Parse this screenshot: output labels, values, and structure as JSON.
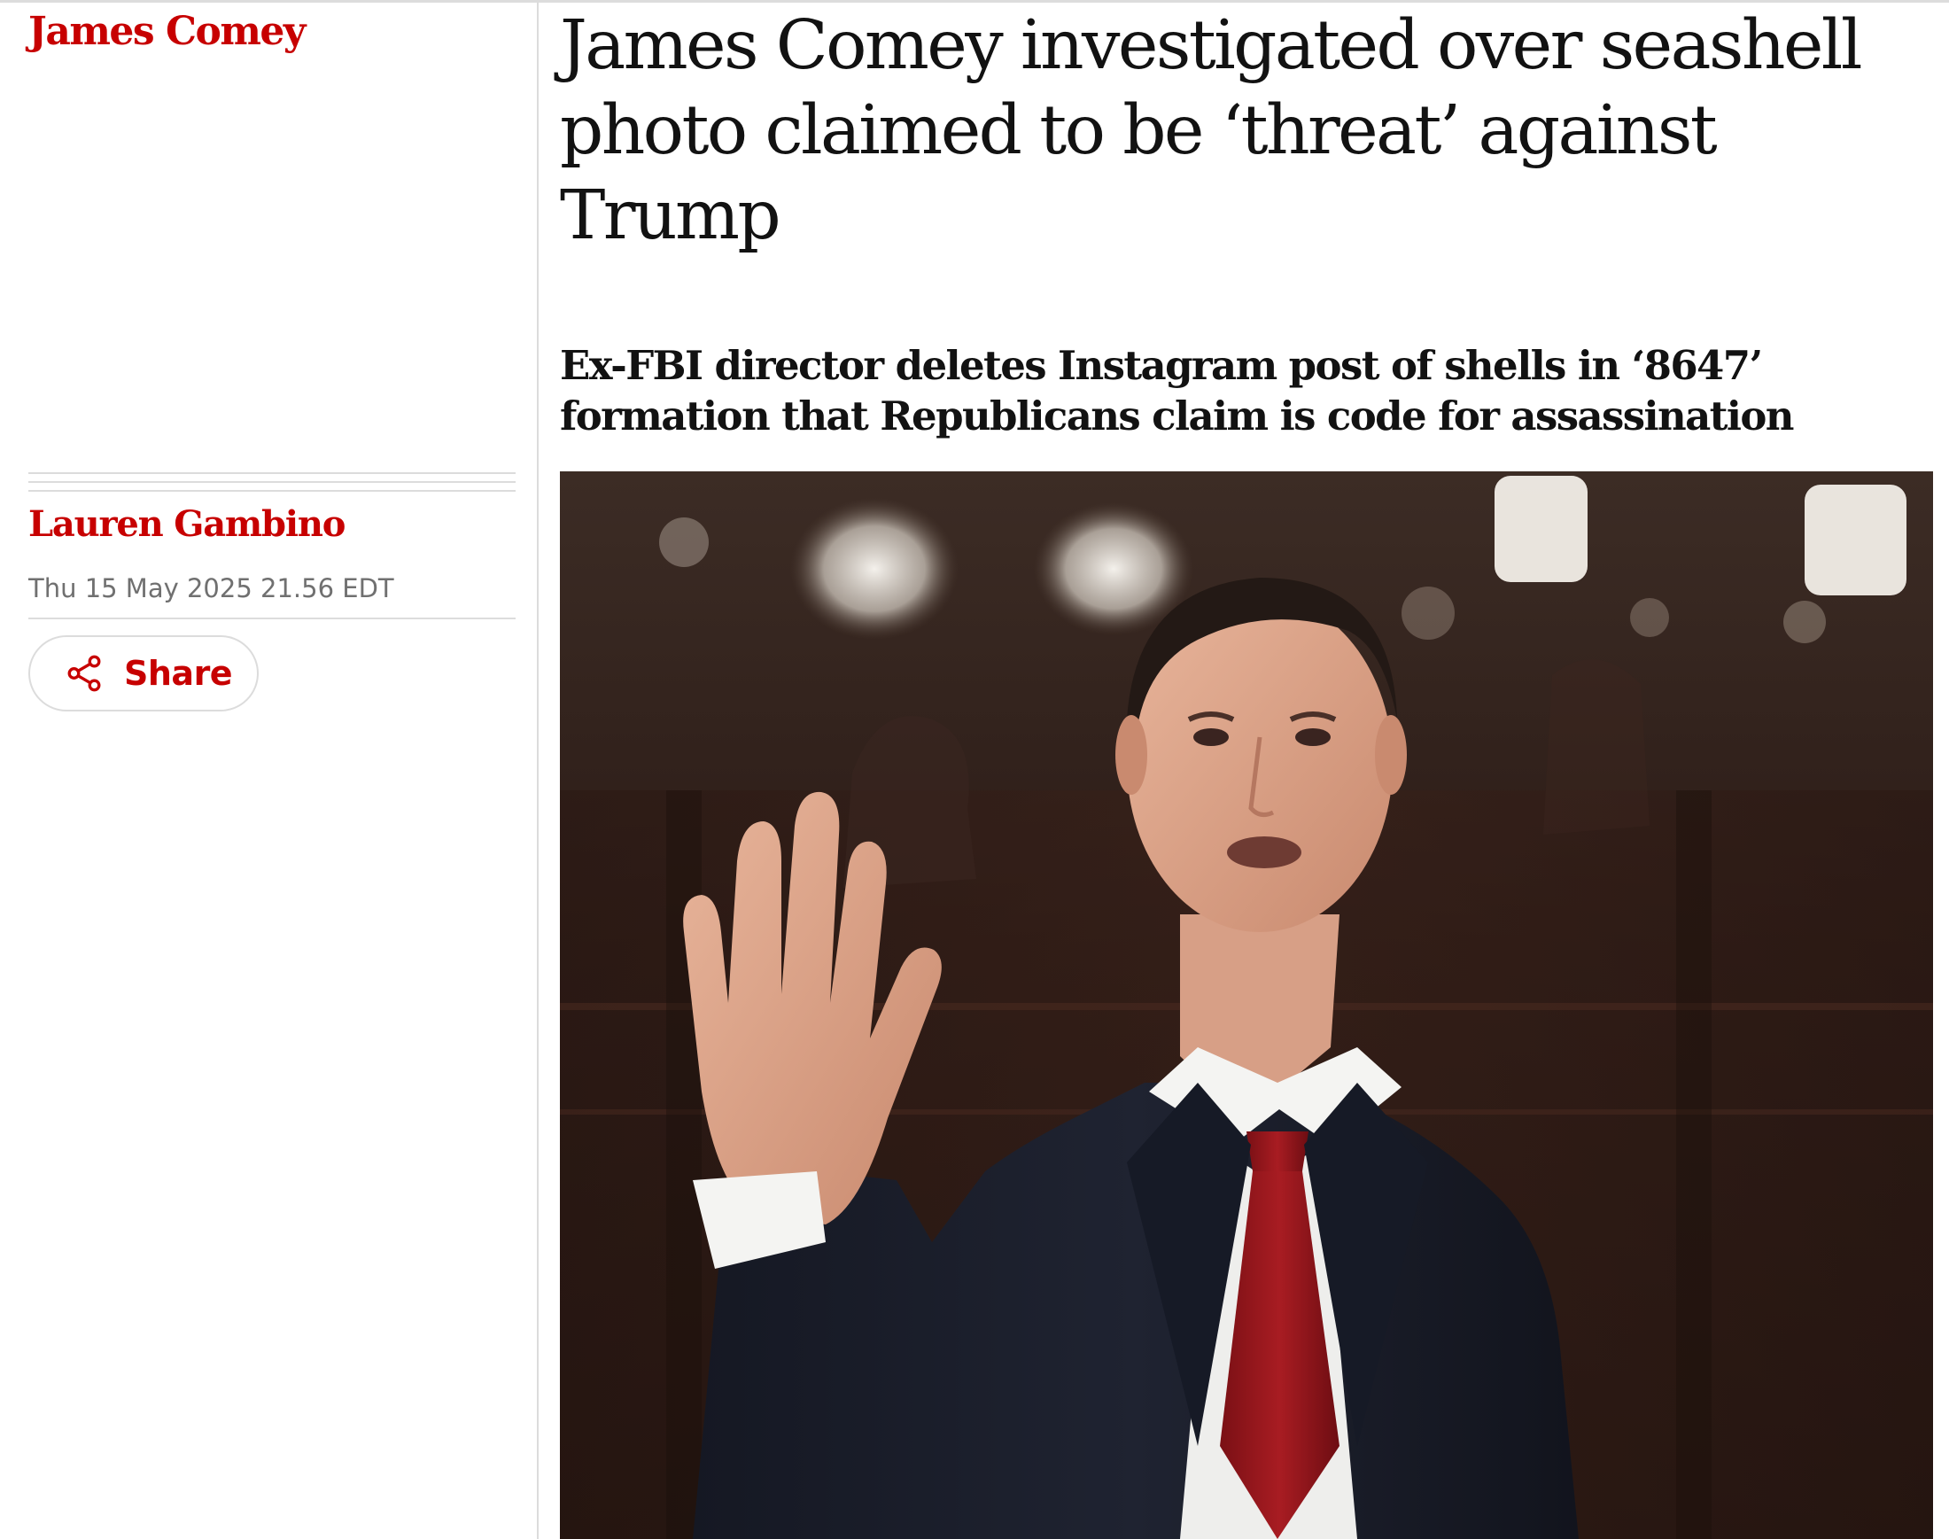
{
  "section": {
    "tag": "James Comey"
  },
  "article": {
    "headline": "James Comey investigated over seashell photo claimed to be ‘threat’ against Trump",
    "standfirst": "Ex-FBI director deletes Instagram post of shells in ‘8647’ formation that Republicans claim is code for assassination",
    "byline": "Lauren Gambino",
    "dateline": "Thu 15 May 2025 21.56 EDT",
    "share_label": "Share"
  },
  "colors": {
    "accent": "#c70000",
    "text": "#121212",
    "muted": "#707070",
    "rule": "#dcdcdc"
  },
  "icons": {
    "share": "share-icon"
  }
}
